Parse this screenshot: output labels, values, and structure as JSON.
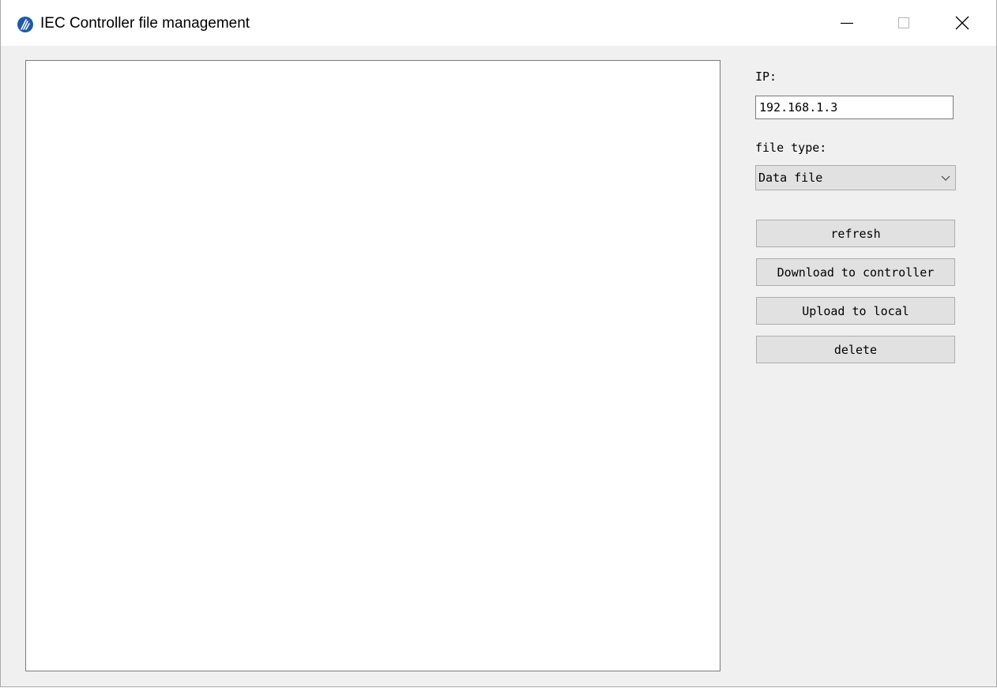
{
  "window": {
    "title": "IEC Controller file management",
    "icon": "app-logo-icon",
    "controls": [
      "minimize-icon",
      "maximize-icon",
      "close-icon"
    ]
  },
  "file_list": {
    "items": []
  },
  "panel": {
    "ip_label": "IP:",
    "ip_value": "192.168.1.3",
    "file_type_label": "file type:",
    "file_type_selected": "Data file",
    "buttons": {
      "refresh": "refresh",
      "download": "Download to controller",
      "upload": "Upload to local",
      "delete": "delete"
    }
  },
  "colors": {
    "window_bg": "#f0f0f0",
    "titlebar_bg": "#ffffff",
    "button_bg": "#e1e1e1",
    "border": "#adadad",
    "logo_blue": "#1f5aa8"
  }
}
